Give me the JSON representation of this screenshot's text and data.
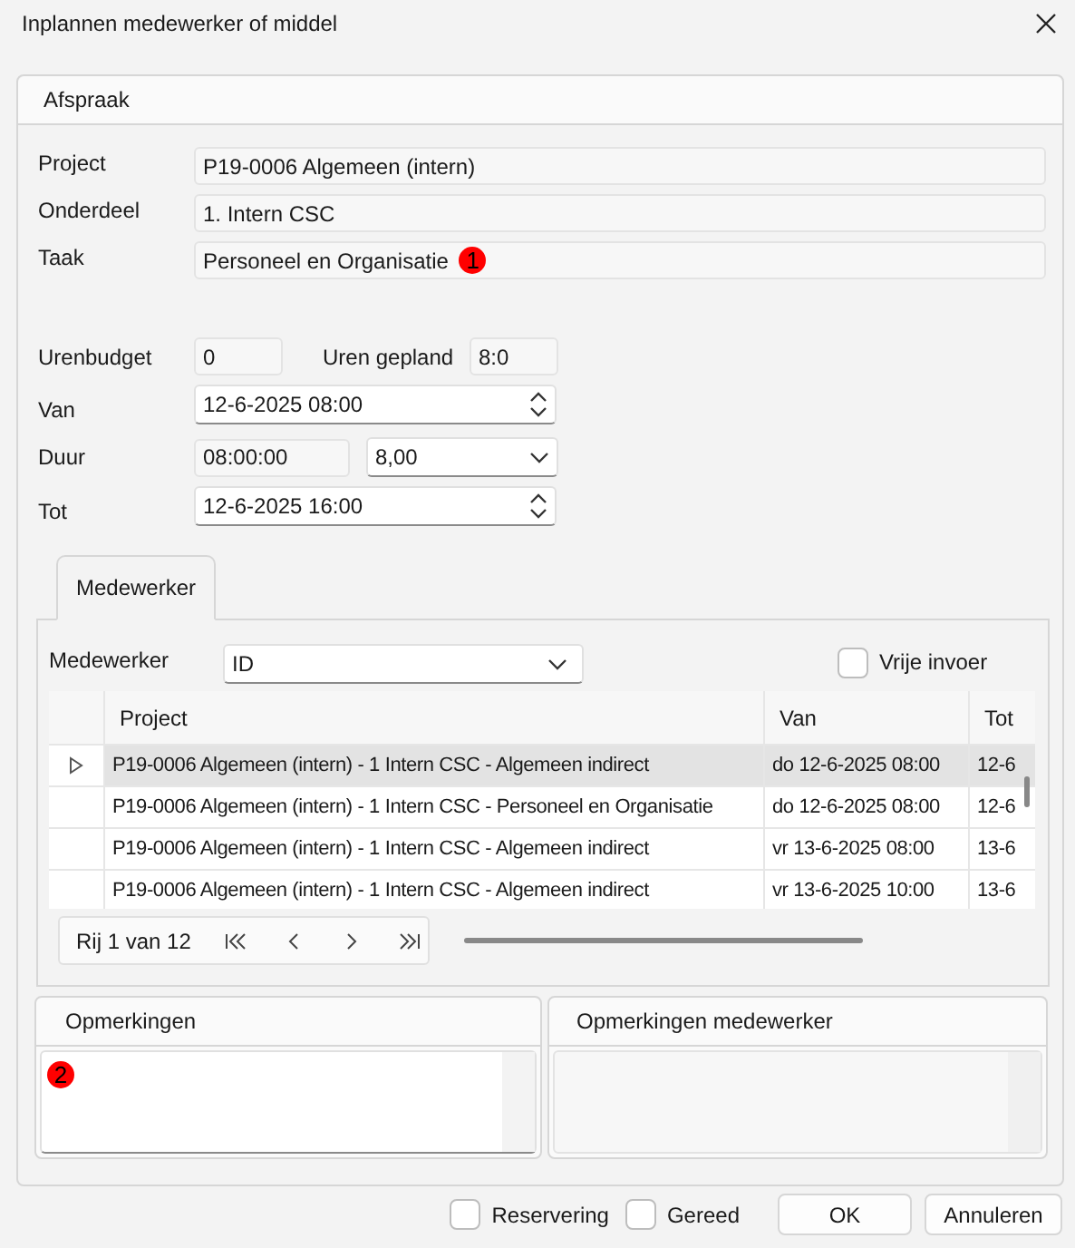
{
  "window": {
    "title": "Inplannen medewerker of middel"
  },
  "section": {
    "label": "Afspraak"
  },
  "details": [
    {
      "label": "Project",
      "value": "P19-0006 Algemeen (intern)"
    },
    {
      "label": "Onderdeel",
      "value": "1. Intern CSC"
    },
    {
      "label": "Taak",
      "value": "Personeel en Organisatie",
      "badge": "1"
    }
  ],
  "hours": {
    "budget_label": "Urenbudget",
    "budget": "0",
    "planned_label": "Uren gepland",
    "planned": "8:0"
  },
  "van": {
    "label": "Van",
    "value": "12-6-2025 08:00"
  },
  "duur": {
    "label": "Duur",
    "time": "08:00:00",
    "hours": "8,00"
  },
  "tot": {
    "label": "Tot",
    "value": "12-6-2025 16:00"
  },
  "tabs": [
    {
      "label": "Medewerker",
      "selected": true
    }
  ],
  "medewerker": {
    "label": "Medewerker",
    "value": "ID"
  },
  "free_entry": {
    "label": "Vrije invoer",
    "checked": false
  },
  "table": {
    "columns": [
      "Project",
      "Van",
      "Tot"
    ],
    "rows": [
      {
        "selected": true,
        "cells": [
          "P19-0006 Algemeen (intern) - 1 Intern CSC - Algemeen indirect",
          "do 12-6-2025 08:00",
          "12-6"
        ]
      },
      {
        "selected": false,
        "cells": [
          "P19-0006 Algemeen (intern) - 1 Intern CSC - Personeel en Organisatie",
          "do 12-6-2025 08:00",
          "12-6"
        ]
      },
      {
        "selected": false,
        "cells": [
          "P19-0006 Algemeen (intern) - 1 Intern CSC - Algemeen indirect",
          "vr 13-6-2025 08:00",
          "13-6"
        ]
      },
      {
        "selected": false,
        "cells": [
          "P19-0006 Algemeen (intern) - 1 Intern CSC - Algemeen indirect",
          "vr 13-6-2025 10:00",
          "13-6"
        ]
      }
    ]
  },
  "pager": {
    "text": "Rij 1 van 12"
  },
  "remarks": {
    "title": "Opmerkingen",
    "badge": "2"
  },
  "employee_remarks": {
    "title": "Opmerkingen medewerker"
  },
  "options": [
    {
      "label": "Reservering",
      "checked": false
    },
    {
      "label": "Gereed",
      "checked": false
    }
  ],
  "buttons": [
    "OK",
    "Annuleren"
  ]
}
